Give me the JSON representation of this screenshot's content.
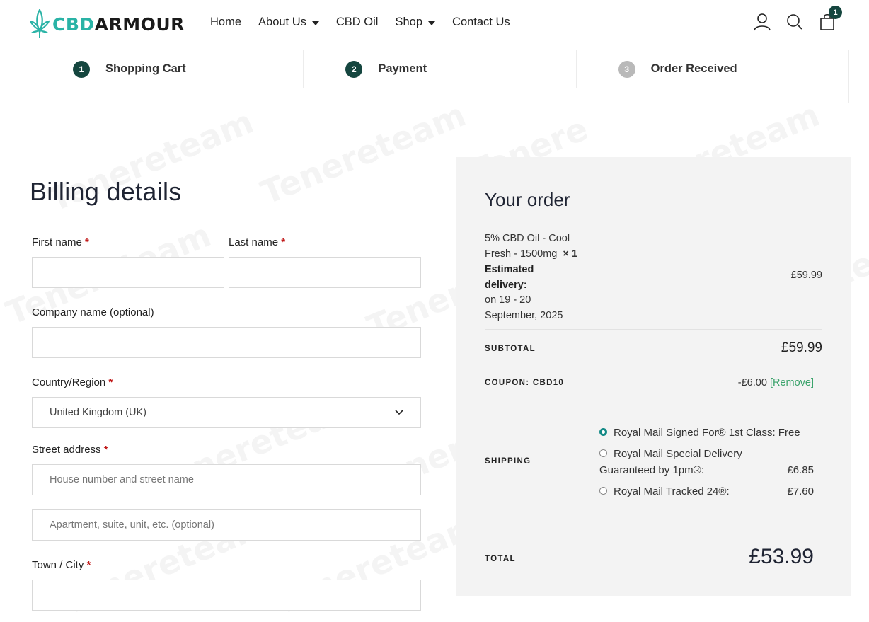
{
  "header": {
    "logo": {
      "part1": "CBD",
      "part2": "ARMOUR"
    },
    "nav": [
      {
        "label": "Home",
        "dropdown": false
      },
      {
        "label": "About Us",
        "dropdown": true
      },
      {
        "label": "CBD Oil",
        "dropdown": false
      },
      {
        "label": "Shop",
        "dropdown": true
      },
      {
        "label": "Contact Us",
        "dropdown": false
      }
    ],
    "cart_count": "1",
    "icons": [
      "user-icon",
      "search-icon",
      "cart-icon"
    ]
  },
  "steps": [
    {
      "number": "1",
      "label": "Shopping Cart",
      "active": true
    },
    {
      "number": "2",
      "label": "Payment",
      "active": true
    },
    {
      "number": "3",
      "label": "Order Received",
      "active": false
    }
  ],
  "billing": {
    "title": "Billing details",
    "first_name_label": "First name",
    "last_name_label": "Last name",
    "company_label": "Company name (optional)",
    "country_label": "Country/Region",
    "country_value": "United Kingdom (UK)",
    "street_label": "Street address",
    "street_placeholder_1": "House number and street name",
    "street_placeholder_2": "Apartment, suite, unit, etc. (optional)",
    "town_label": "Town / City",
    "required_mark": "*"
  },
  "order": {
    "title": "Your order",
    "item": {
      "name_line1": "5% CBD Oil - Cool",
      "name_line2": "Fresh - 1500mg",
      "qty": "× 1",
      "delivery_label_1": "Estimated",
      "delivery_label_2": "delivery:",
      "delivery_value_1": "on 19 - 20",
      "delivery_value_2": "September, 2025",
      "price": "£59.99"
    },
    "subtotal_label": "SUBTOTAL",
    "subtotal_value": "£59.99",
    "coupon_label": "COUPON: CBD10",
    "coupon_value": "-£6.00",
    "coupon_remove": "[Remove]",
    "shipping_label": "SHIPPING",
    "shipping_options": [
      {
        "label": "Royal Mail Signed For® 1st Class: Free",
        "checked": true
      },
      {
        "label_line1": "Royal Mail Special Delivery",
        "label_line2": "Guaranteed by 1pm®:",
        "price": "£6.85",
        "checked": false
      },
      {
        "label": "Royal Mail Tracked 24®:",
        "price": "£7.60",
        "checked": false
      }
    ],
    "total_label": "TOTAL",
    "total_value": "£53.99"
  },
  "colors": {
    "brand_teal": "#2ab3a6",
    "brand_dark": "#15463f",
    "required": "#c11a1a",
    "link_green": "#3aa36b",
    "panel_bg": "#f3f3f3"
  }
}
